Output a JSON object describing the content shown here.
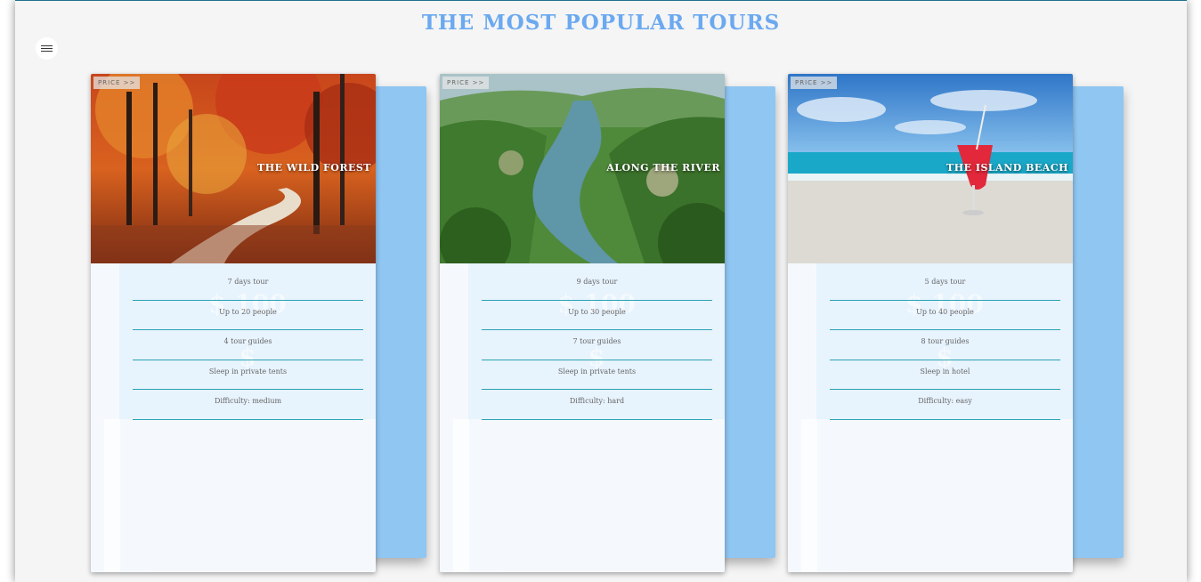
{
  "page": {
    "title": "THE MOST POPULAR TOURS"
  },
  "menu": {
    "icon": "hamburger-menu-icon"
  },
  "tours": [
    {
      "name": "THE WILD FOREST",
      "price_label": "PRICE >>",
      "image": "autumn-forest-path-photo",
      "details": [
        "7 days tour",
        "Up to 20 people",
        "4 tour guides",
        "Sleep in private tents",
        "Difficulty: medium"
      ]
    },
    {
      "name": "ALONG THE RIVER",
      "price_label": "PRICE >>",
      "image": "river-valley-photo",
      "details": [
        "9 days tour",
        "Up to 30 people",
        "7 tour guides",
        "Sleep in private tents",
        "Difficulty: hard"
      ]
    },
    {
      "name": "THE ISLAND BEACH",
      "price_label": "PRICE >>",
      "image": "beach-cocktail-photo",
      "details": [
        "5 days tour",
        "Up to 40 people",
        "8 tour guides",
        "Sleep in hotel",
        "Difficulty: easy"
      ]
    }
  ],
  "colors": {
    "title": "#6ba9f0",
    "card_back": "#90c6f2",
    "divider": "#2aa3b5"
  }
}
